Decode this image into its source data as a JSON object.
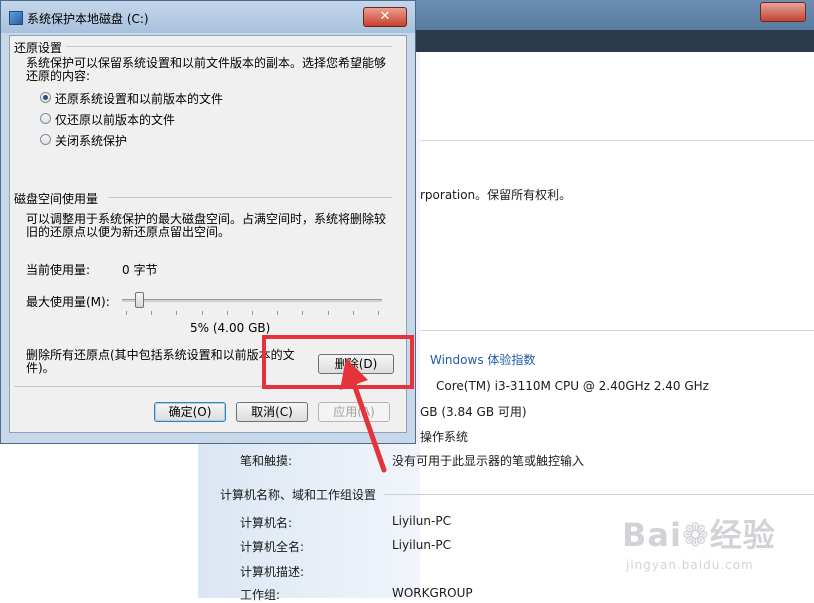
{
  "background_window": {
    "copyright_tail": "rporation。保留所有权利。",
    "rating_link": "Windows 体验指数",
    "processor_value": "Core(TM) i3-3110M CPU @ 2.40GHz   2.40 GHz",
    "memory_value": "GB (3.84 GB 可用)",
    "system_type_value": "操作系统",
    "pen_touch_label": "笔和触摸:",
    "pen_touch_value": "没有可用于此显示器的笔或触控输入",
    "section_title": "计算机名称、域和工作组设置",
    "rows": [
      {
        "label": "计算机名:",
        "value": "Liyilun-PC"
      },
      {
        "label": "计算机全名:",
        "value": "Liyilun-PC"
      },
      {
        "label": "计算机描述:",
        "value": ""
      },
      {
        "label": "工作组:",
        "value": "WORKGROUP"
      }
    ],
    "watermark_logo": "Bai❁经验",
    "watermark_url": "jingyan.baidu.com"
  },
  "dialog": {
    "title": "系统保护本地磁盘 (C:)",
    "close_glyph": "✕",
    "restore_settings": {
      "heading": "还原设置",
      "description": "系统保护可以保留系统设置和以前文件版本的副本。选择您希望能够还原的内容:",
      "options": [
        {
          "label": "还原系统设置和以前版本的文件",
          "checked": true
        },
        {
          "label": "仅还原以前版本的文件",
          "checked": false
        },
        {
          "label": "关闭系统保护",
          "checked": false
        }
      ]
    },
    "disk_usage": {
      "heading": "磁盘空间使用量",
      "description": "可以调整用于系统保护的最大磁盘空间。占满空间时，系统将删除较旧的还原点以便为新还原点留出空间。",
      "current_label": "当前使用量:",
      "current_value": "0 字节",
      "max_label": "最大使用量(M):",
      "slider_percent": 5,
      "slider_readout": "5% (4.00 GB)"
    },
    "delete_text": "删除所有还原点(其中包括系统设置和以前版本的文件)。",
    "delete_button": "删除(D)",
    "ok_button": "确定(O)",
    "cancel_button": "取消(C)",
    "apply_button": "应用(A)"
  },
  "annotation": {
    "color": "#e4333a"
  }
}
